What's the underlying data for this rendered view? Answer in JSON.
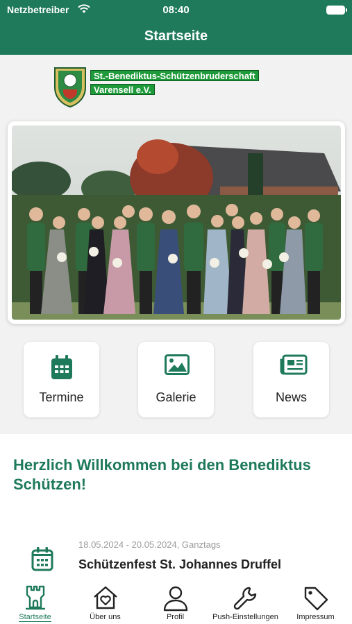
{
  "status_bar": {
    "carrier": "Netzbetreiber",
    "time": "08:40"
  },
  "nav": {
    "title": "Startseite"
  },
  "logo": {
    "line1": "St.-Benediktus-Schützenbruderschaft",
    "line2": "Varensell e.V."
  },
  "tiles": [
    {
      "label": "Termine",
      "icon": "calendar-icon"
    },
    {
      "label": "Galerie",
      "icon": "image-icon"
    },
    {
      "label": "News",
      "icon": "newspaper-icon"
    }
  ],
  "welcome": {
    "heading": "Herzlich Willkommen bei den Benediktus Schützen!"
  },
  "event": {
    "date": "18.05.2024 - 20.05.2024, Ganztags",
    "title": "Schützenfest St. Johannes Druffel",
    "icon": "calendar-icon"
  },
  "tabs": [
    {
      "label": "Startseite",
      "icon": "castle-icon",
      "active": true
    },
    {
      "label": "Über uns",
      "icon": "house-heart-icon"
    },
    {
      "label": "Profil",
      "icon": "person-icon"
    },
    {
      "label": "Push-Einstellungen",
      "icon": "wrench-icon"
    },
    {
      "label": "Impressum",
      "icon": "tag-icon"
    }
  ],
  "colors": {
    "primary": "#1f7a5c",
    "background": "#f2f2f2",
    "logo_green": "#1f9a3a"
  }
}
